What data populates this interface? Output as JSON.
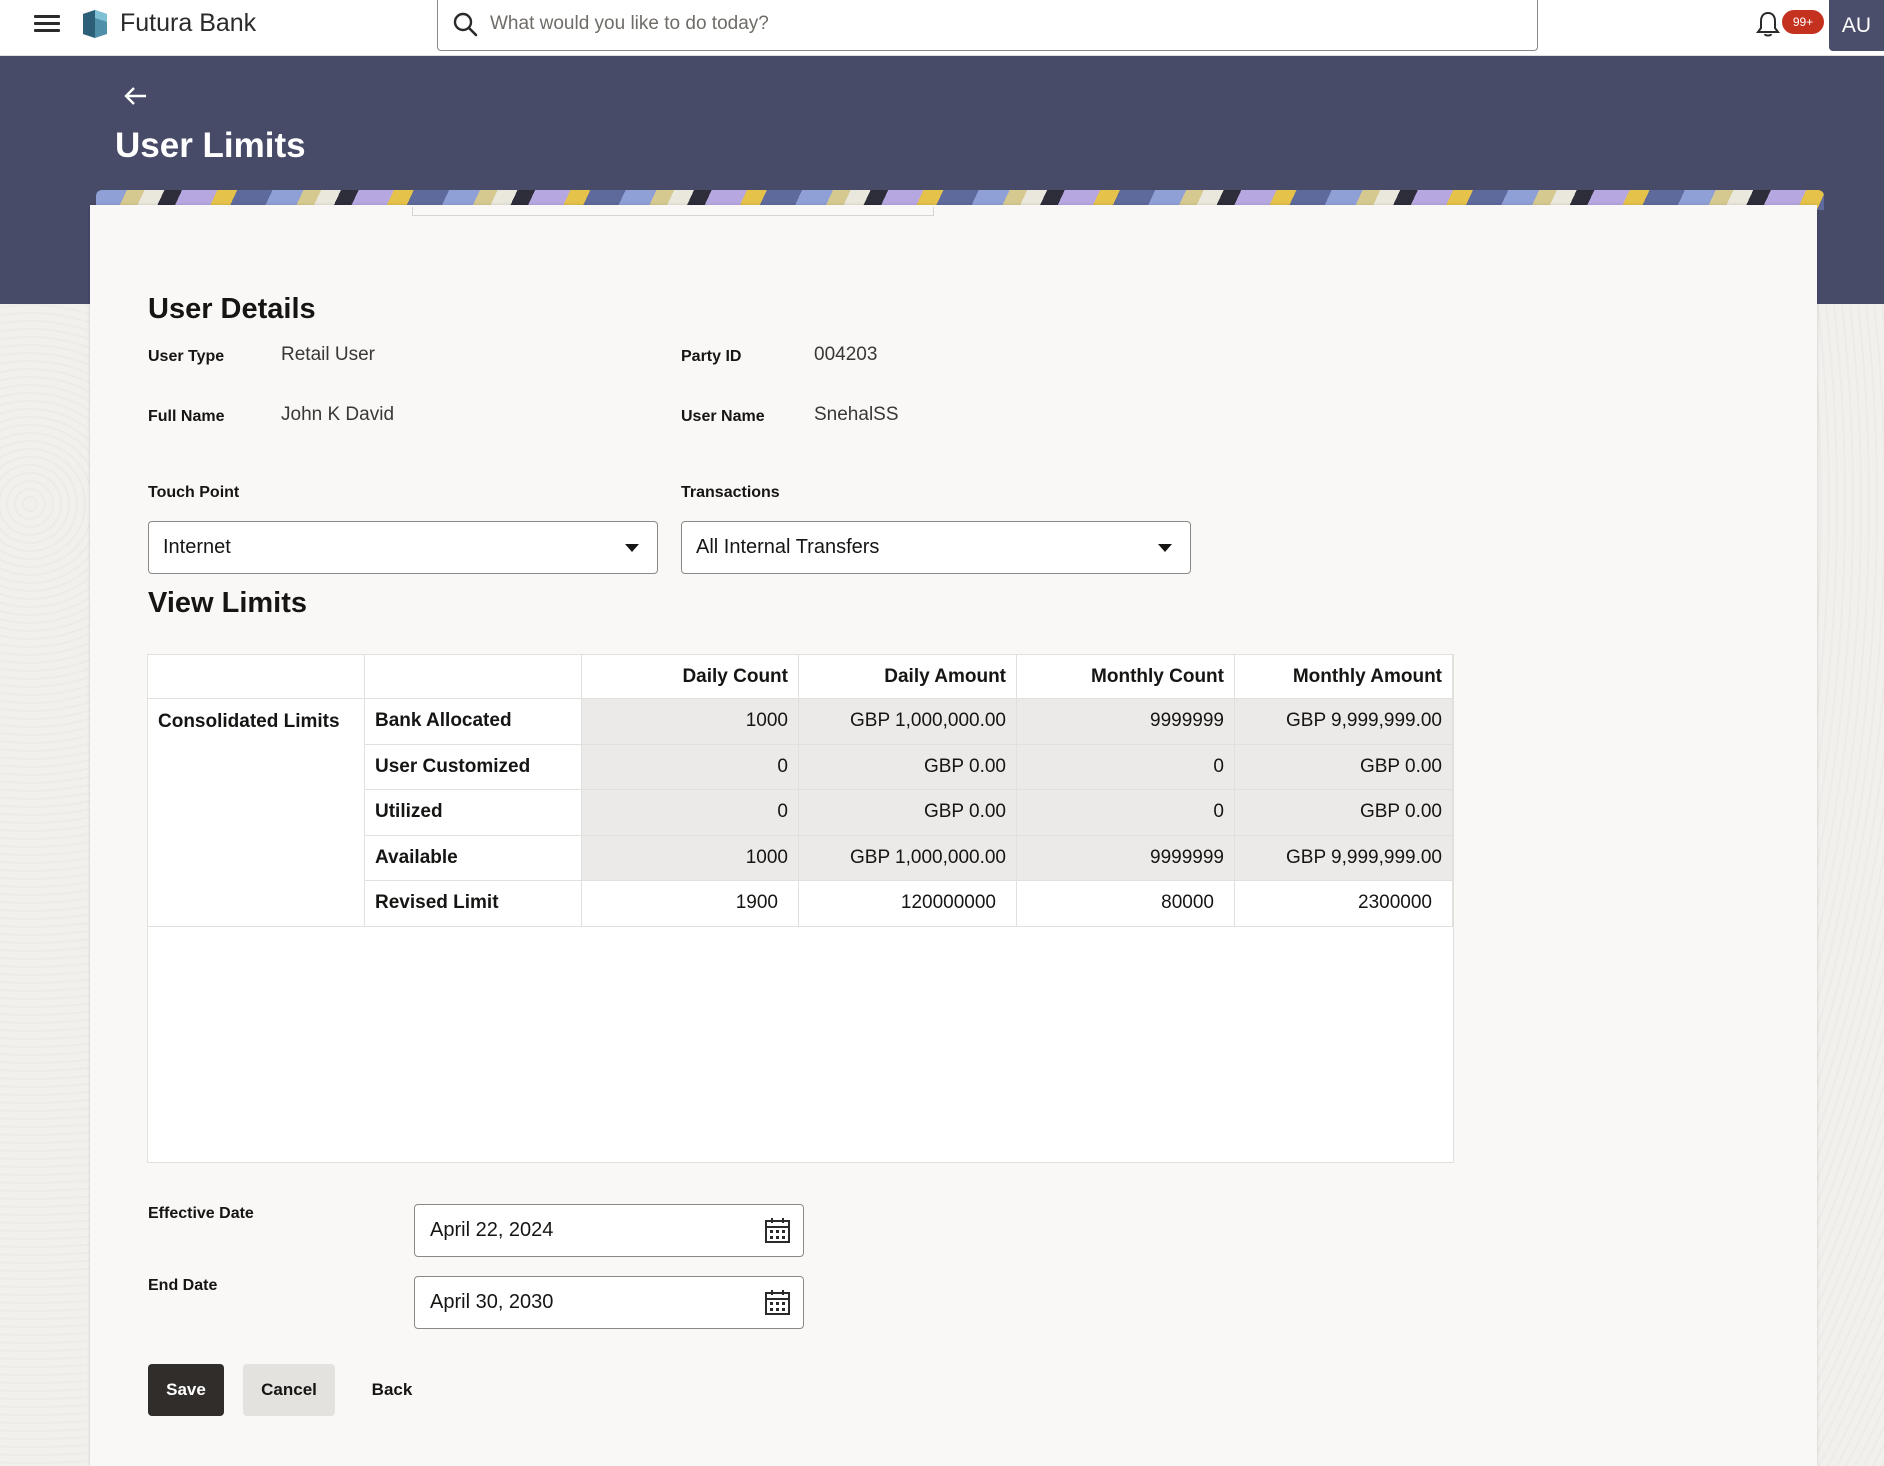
{
  "app": {
    "brand": "Futura Bank",
    "search_placeholder": "What would you like to do today?",
    "notification_count": "99+",
    "avatar_initials": "AU",
    "colors": {
      "banner": "#474b68",
      "primary_button": "#312d2a",
      "badge": "#c5311f"
    }
  },
  "page": {
    "title": "User Limits"
  },
  "user_details": {
    "heading": "User Details",
    "user_type_label": "User Type",
    "user_type": "Retail User",
    "party_id_label": "Party ID",
    "party_id": "004203",
    "full_name_label": "Full Name",
    "full_name": "John K David",
    "user_name_label": "User Name",
    "user_name": "SnehalSS"
  },
  "filters": {
    "touch_point_label": "Touch Point",
    "touch_point": "Internet",
    "transactions_label": "Transactions",
    "transactions": "All Internal Transfers"
  },
  "limits": {
    "heading": "View Limits",
    "columns": [
      "Daily Count",
      "Daily Amount",
      "Monthly Count",
      "Monthly Amount"
    ],
    "group_label": "Consolidated Limits",
    "rows": [
      {
        "label": "Bank Allocated",
        "values": [
          "1000",
          "GBP 1,000,000.00",
          "9999999",
          "GBP 9,999,999.00"
        ]
      },
      {
        "label": "User Customized",
        "values": [
          "0",
          "GBP 0.00",
          "0",
          "GBP 0.00"
        ]
      },
      {
        "label": "Utilized",
        "values": [
          "0",
          "GBP 0.00",
          "0",
          "GBP 0.00"
        ]
      },
      {
        "label": "Available",
        "values": [
          "1000",
          "GBP 1,000,000.00",
          "9999999",
          "GBP 9,999,999.00"
        ]
      },
      {
        "label": "Revised Limit",
        "values": [
          "1900",
          "120000000",
          "80000",
          "2300000"
        ]
      }
    ]
  },
  "dates": {
    "effective_label": "Effective Date",
    "effective_value": "April 22, 2024",
    "end_label": "End Date",
    "end_value": "April 30, 2030"
  },
  "actions": {
    "save": "Save",
    "cancel": "Cancel",
    "back": "Back"
  }
}
